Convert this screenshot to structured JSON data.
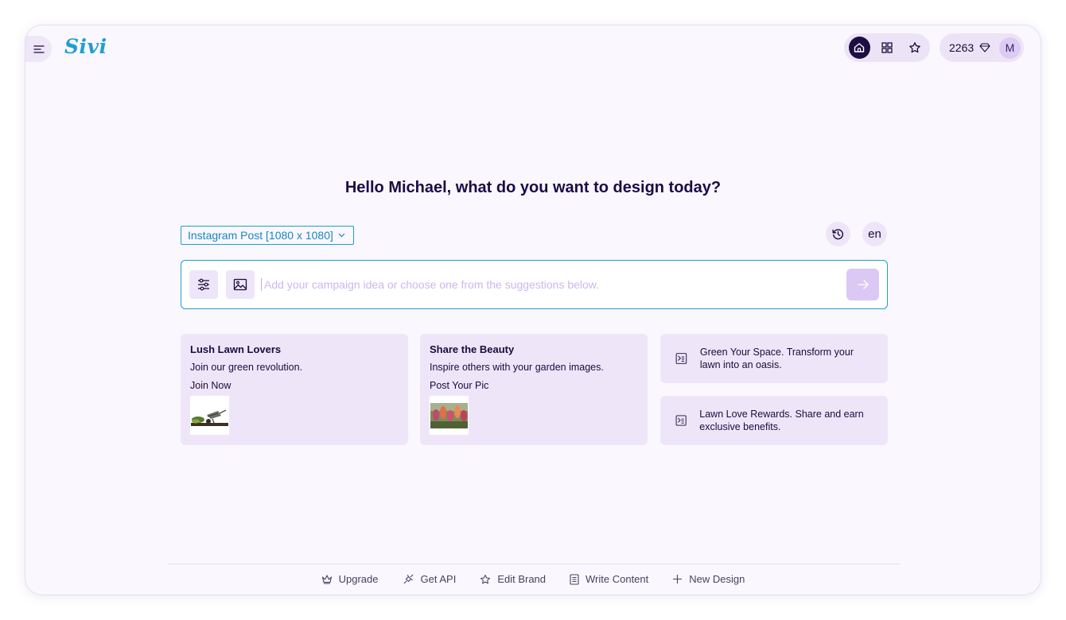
{
  "header": {
    "logo": "Sivi",
    "credits": "2263",
    "avatar_initial": "M"
  },
  "main": {
    "greeting": "Hello Michael, what do you want to design today?",
    "format_select": "Instagram Post [1080 x 1080]",
    "language": "en",
    "prompt_placeholder": "Add your campaign idea or choose one from the suggestions below.",
    "suggestions": [
      {
        "title": "Lush Lawn Lovers",
        "subtitle": "Join our green revolution.",
        "cta": "Join Now"
      },
      {
        "title": "Share the Beauty",
        "subtitle": "Inspire others with your garden images.",
        "cta": "Post Your Pic"
      }
    ],
    "ideas": [
      {
        "text": "Green Your Space. Transform your lawn into an oasis."
      },
      {
        "text": "Lawn Love Rewards. Share and earn exclusive benefits."
      }
    ]
  },
  "footer": {
    "links": [
      "Upgrade",
      "Get API",
      "Edit Brand",
      "Write Content",
      "New Design"
    ]
  },
  "colors": {
    "accent": "#1f9fd0",
    "dark": "#1b0b45",
    "card": "#eee6f8",
    "send": "#dcc8f5"
  }
}
